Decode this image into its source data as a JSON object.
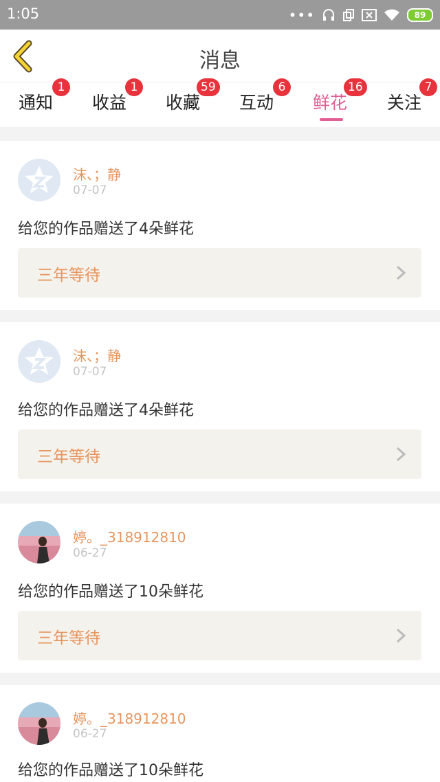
{
  "status_bar": {
    "time": "1:05",
    "battery": "89"
  },
  "header": {
    "title": "消息"
  },
  "tabs": [
    {
      "label": "通知",
      "badge": "1"
    },
    {
      "label": "收益",
      "badge": "1"
    },
    {
      "label": "收藏",
      "badge": "59"
    },
    {
      "label": "互动",
      "badge": "6"
    },
    {
      "label": "鲜花",
      "badge": "16",
      "active": true
    },
    {
      "label": "关注",
      "badge": "7"
    }
  ],
  "items": [
    {
      "user": "沫、；静",
      "date": "07-07",
      "message": "给您的作品赠送了4朵鲜花",
      "work": "三年等待",
      "avatar": "qq-avatar"
    },
    {
      "user": "沫、；静",
      "date": "07-07",
      "message": "给您的作品赠送了4朵鲜花",
      "work": "三年等待",
      "avatar": "qq-avatar"
    },
    {
      "user": "婷。_318912810",
      "date": "06-27",
      "message": "给您的作品赠送了10朵鲜花",
      "work": "三年等待",
      "avatar": "photo-avatar"
    },
    {
      "user": "婷。_318912810",
      "date": "06-27",
      "message": "给您的作品赠送了10朵鲜花",
      "work": "",
      "avatar": "photo-avatar"
    }
  ],
  "colors": {
    "accent": "#e45e96",
    "badge": "#e8323c",
    "username": "#e7945d"
  }
}
